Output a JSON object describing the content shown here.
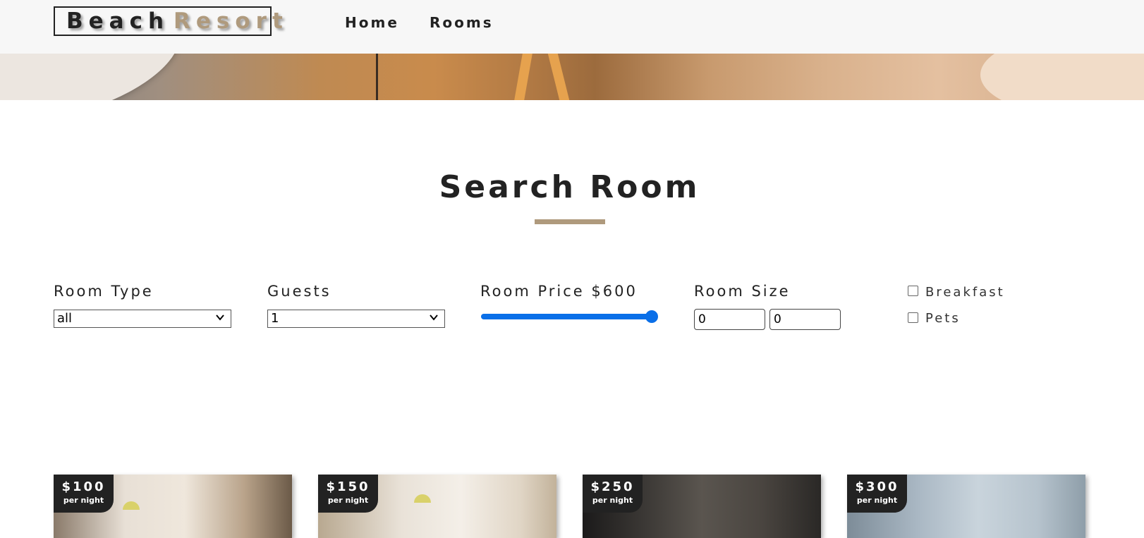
{
  "header": {
    "logo_word1": "Beach",
    "logo_word2": "Resort",
    "nav": [
      {
        "label": "Home"
      },
      {
        "label": "Rooms"
      }
    ]
  },
  "search": {
    "title": "Search Room",
    "room_type": {
      "label": "Room Type",
      "selected": "all",
      "icon": "chevron-down-icon"
    },
    "guests": {
      "label": "Guests",
      "selected": "1",
      "icon": "chevron-down-icon"
    },
    "price": {
      "label": "Room Price $600",
      "value": 600,
      "max": 600
    },
    "size": {
      "label": "Room Size",
      "min_value": "0",
      "max_value": "0"
    },
    "options": [
      {
        "label": "Breakfast",
        "checked": false
      },
      {
        "label": "Pets",
        "checked": false
      }
    ]
  },
  "rooms": [
    {
      "price": "$100",
      "per": "per night"
    },
    {
      "price": "$150",
      "per": "per night"
    },
    {
      "price": "$250",
      "per": "per night"
    },
    {
      "price": "$300",
      "per": "per night"
    }
  ],
  "colors": {
    "accent": "#af9a7d",
    "slider": "#0a6fe8",
    "dark": "#222222",
    "navbar_bg": "#f7f7f7"
  }
}
